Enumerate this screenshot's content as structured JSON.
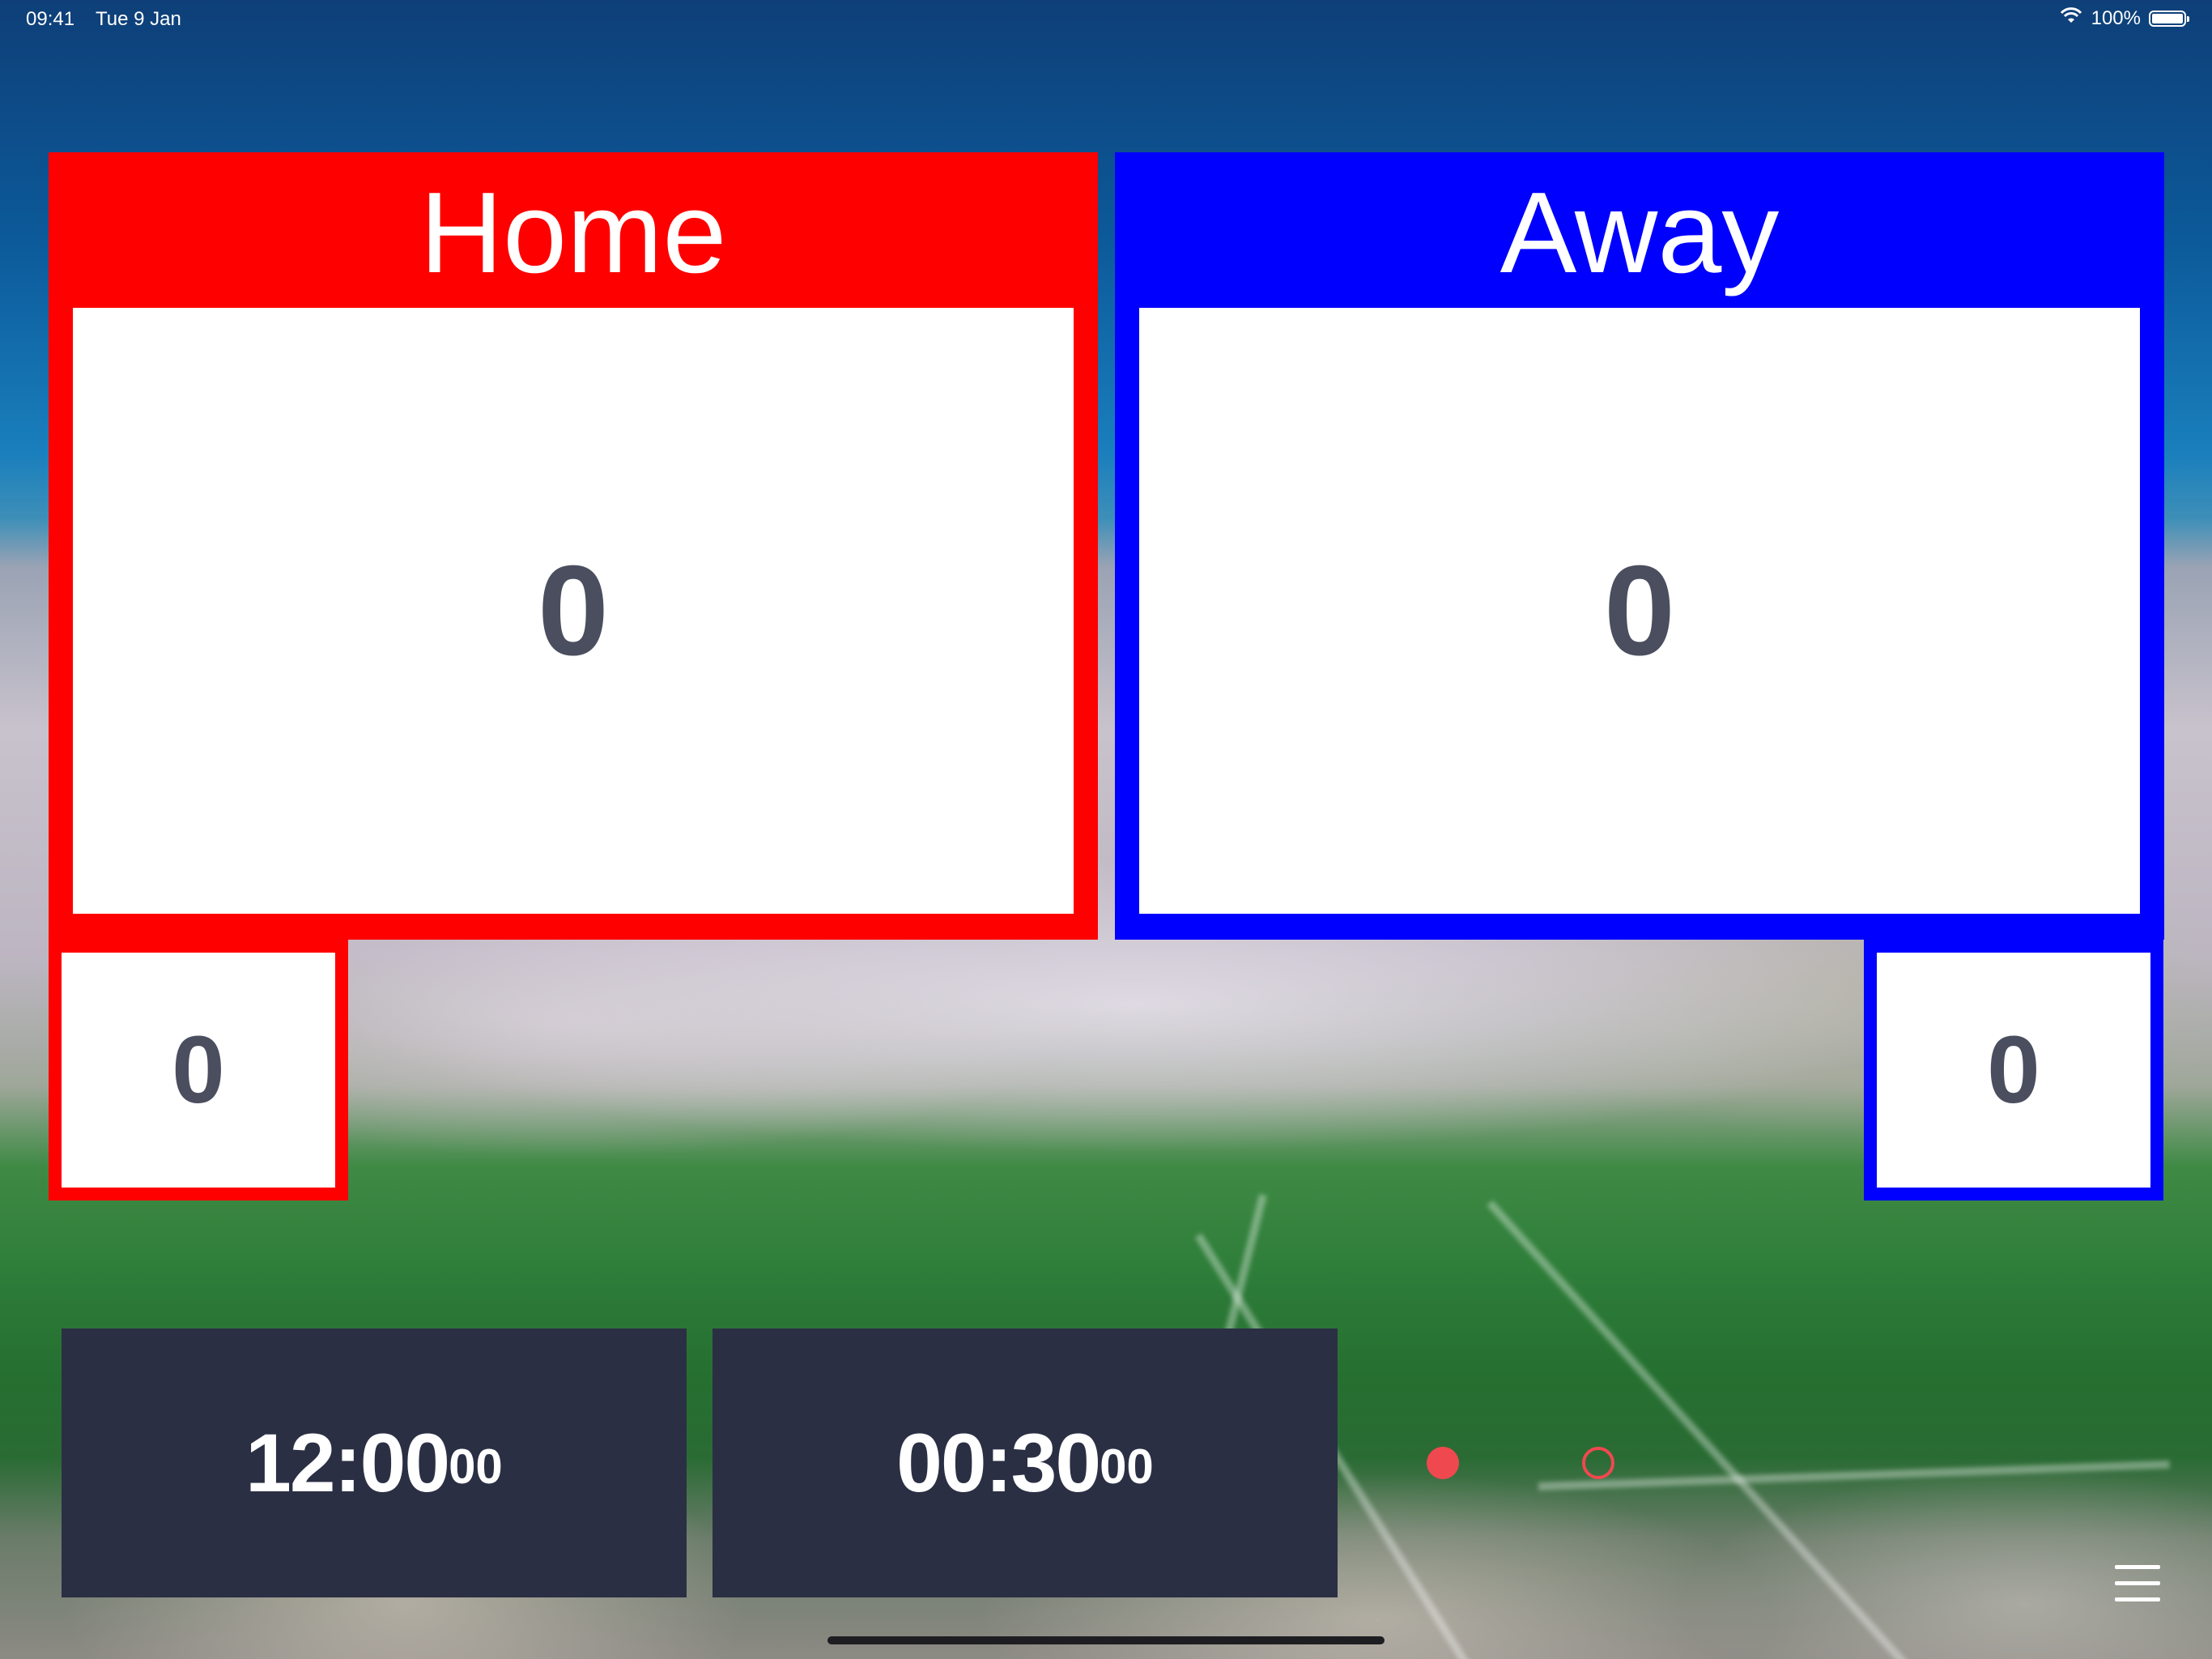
{
  "status_bar": {
    "time": "09:41",
    "date": "Tue 9 Jan",
    "battery_label": "100%"
  },
  "home": {
    "name": "Home",
    "score": "0",
    "secondary": "0",
    "color": "#ff0000"
  },
  "away": {
    "name": "Away",
    "score": "0",
    "secondary": "0",
    "color": "#0000ff"
  },
  "game_clock": {
    "main": "12:00",
    "sub": "00"
  },
  "shot_clock": {
    "main": "00:30",
    "sub": "00"
  },
  "pager": {
    "pages": 2,
    "current": 1,
    "color": "#f0484f"
  },
  "icons": {
    "menu": "hamburger-menu-icon",
    "wifi": "wifi-icon",
    "battery": "battery-icon"
  }
}
